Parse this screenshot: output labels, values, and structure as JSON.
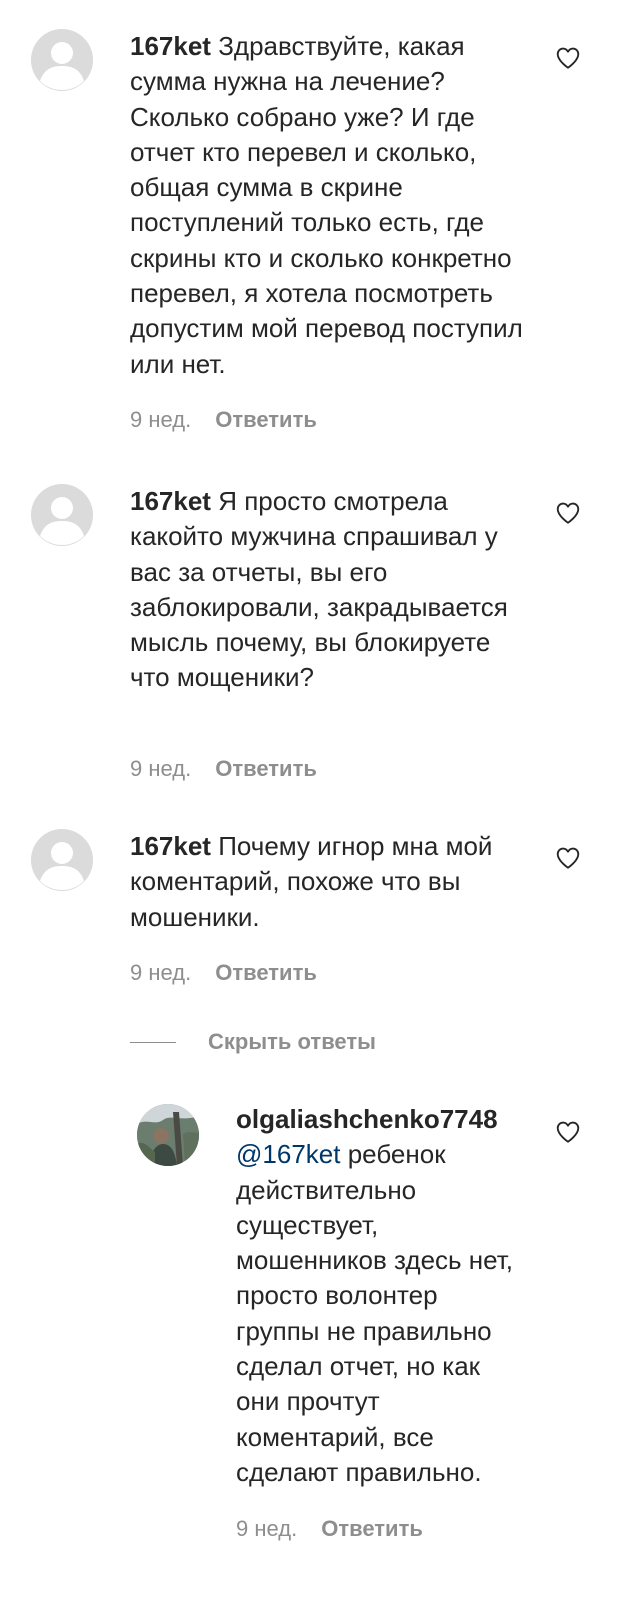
{
  "comments": [
    {
      "username": "167ket",
      "mention": "",
      "text": "Здравствуйте, какая сумма нужна на лечение? Сколько собрано уже? И где отчет кто перевел и сколько, общая сумма в скрине поступлений только есть, где скрины кто и сколько конкретно перевел, я хотела посмотреть допустим мой перевод поступил или нет.",
      "time": "9 нед.",
      "reply_label": "Ответить",
      "like_icon": "heart-outline-icon",
      "avatar": "default-avatar-icon"
    },
    {
      "username": "167ket",
      "mention": "",
      "text": "Я просто смотрела какойто мужчина спрашивал у вас за отчеты, вы его заблокировали, закрадывается мысль почему, вы блокируете что мощеники?",
      "time": "9 нед.",
      "reply_label": "Ответить",
      "like_icon": "heart-outline-icon",
      "avatar": "default-avatar-icon"
    },
    {
      "username": "167ket",
      "mention": "",
      "text": "Почему игнор мна мой коментарий, похоже что вы мошеники.",
      "time": "9 нед.",
      "reply_label": "Ответить",
      "like_icon": "heart-outline-icon",
      "avatar": "default-avatar-icon"
    }
  ],
  "hide_replies_label": "Скрыть ответы",
  "reply": {
    "username": "olgaliashchenko7748",
    "mention": "@167ket",
    "text": "ребенок действительно существует, мошенников здесь нет, просто волонтер группы не правильно сделал отчет, но как они прочтут коментарий, все сделают правильно.",
    "time": "9 нед.",
    "reply_label": "Ответить",
    "like_icon": "heart-outline-icon",
    "avatar": "user-photo-avatar"
  },
  "colors": {
    "text": "#262626",
    "secondary": "#8e8e8e",
    "mention": "#00376b",
    "avatar_placeholder": "#dbdbdb"
  }
}
